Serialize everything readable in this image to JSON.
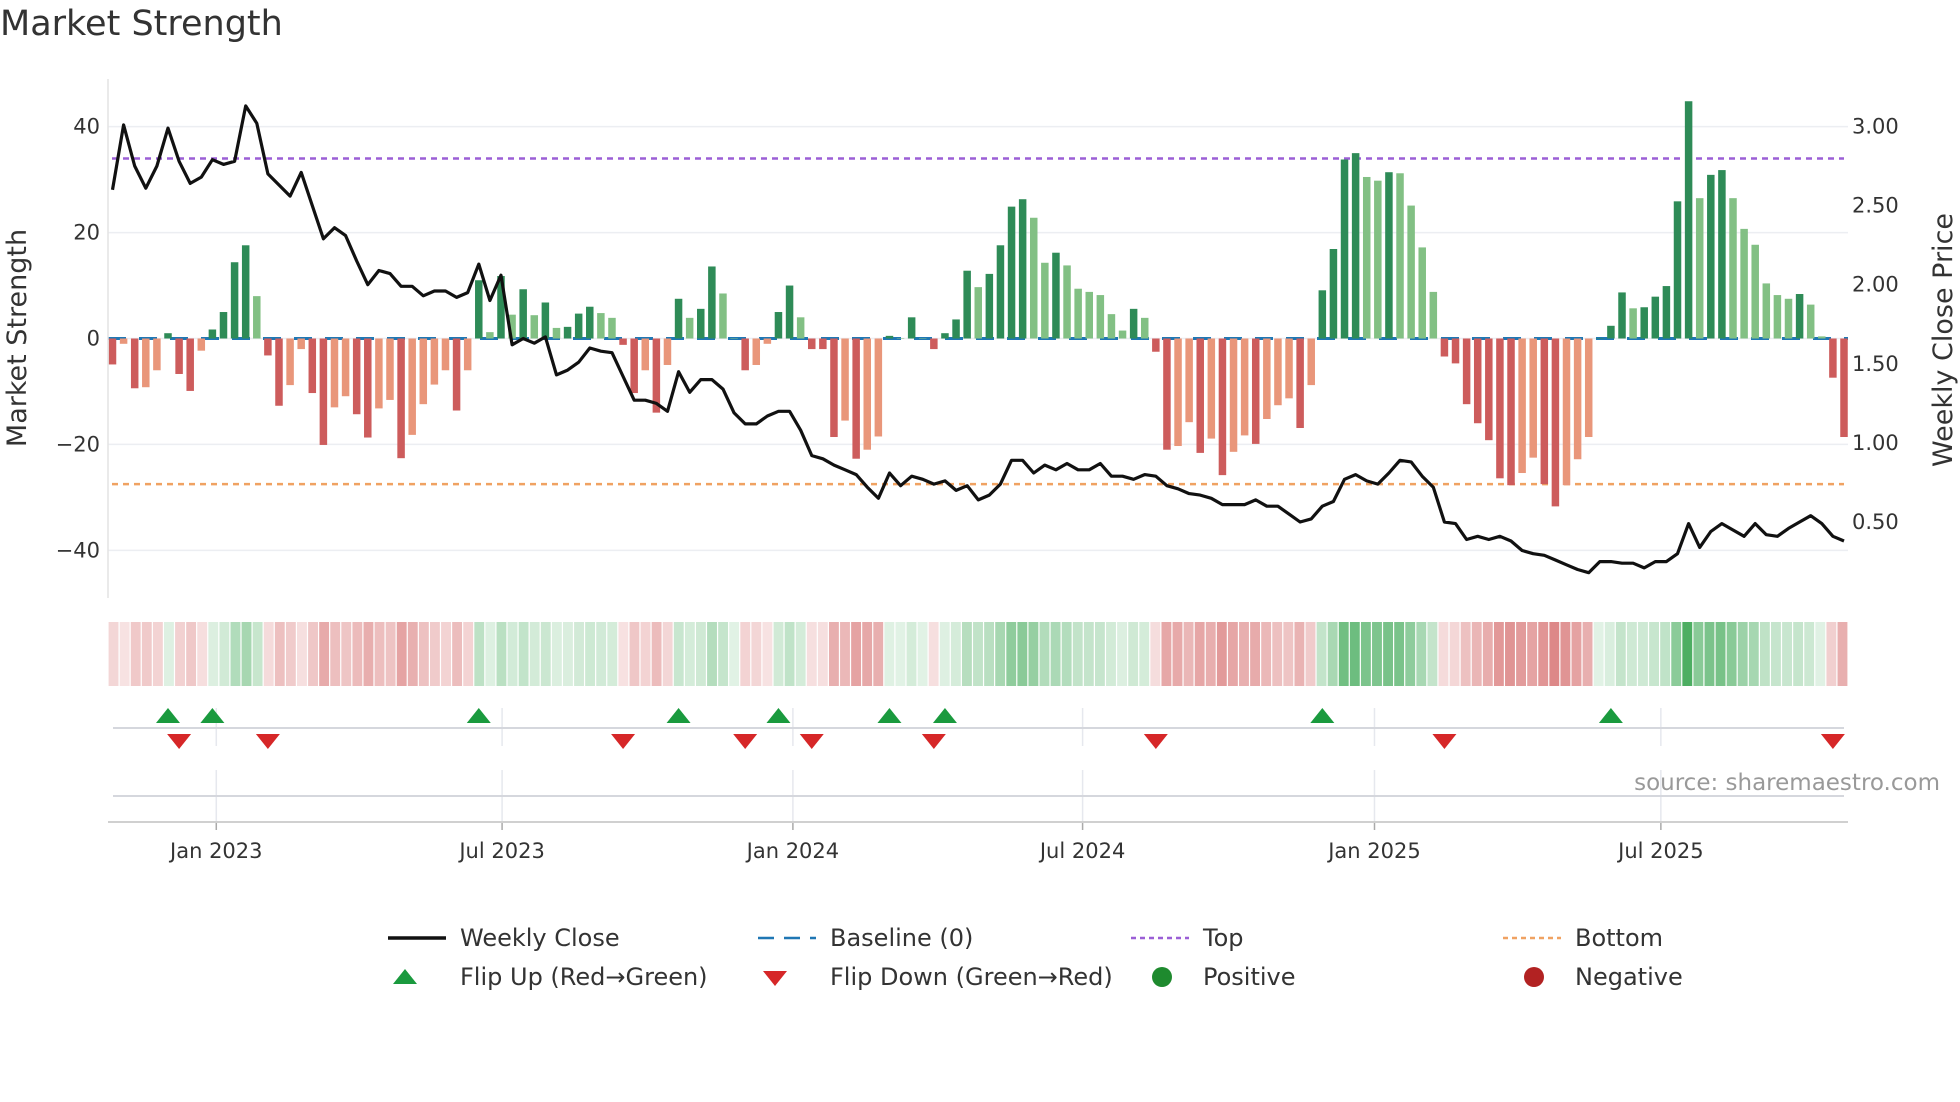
{
  "title": "Market Strength",
  "source": "source: sharemaestro.com",
  "legend": {
    "weekly_close": "Weekly Close",
    "baseline": "Baseline (0)",
    "top": "Top",
    "bottom": "Bottom",
    "flip_up": "Flip Up (Red→Green)",
    "flip_down": "Flip Down (Green→Red)",
    "positive": "Positive",
    "negative": "Negative"
  },
  "colors": {
    "pos_dark": "#2e8b57",
    "pos_light": "#82c084",
    "neg_dark": "#cd5c5c",
    "neg_light": "#e9967a",
    "close": "#111111",
    "top": "#9b5fd6",
    "bottom": "#f0a262",
    "baseline": "#1f77b4",
    "flip_up": "#1a9a3e",
    "flip_down": "#d62728",
    "positive": "#1e8a2e",
    "negative": "#b22222"
  },
  "chart_data": {
    "type": "bar",
    "title": "Market Strength",
    "ylabel": "Market Strength",
    "y2label": "Weekly Close Price",
    "ylim": [
      -49,
      49
    ],
    "y2lim": [
      0.02,
      3.3
    ],
    "yticks": [
      {
        "v": 40,
        "label": "40"
      },
      {
        "v": 20,
        "label": "20"
      },
      {
        "v": 0,
        "label": "0"
      },
      {
        "v": -20,
        "label": "−20"
      },
      {
        "v": -40,
        "label": "−40"
      }
    ],
    "y2ticks": [
      {
        "v": 3.0,
        "label": "3.00"
      },
      {
        "v": 2.5,
        "label": "2.50"
      },
      {
        "v": 2.0,
        "label": "2.00"
      },
      {
        "v": 1.5,
        "label": "1.50"
      },
      {
        "v": 1.0,
        "label": "1.00"
      },
      {
        "v": 0.5,
        "label": "0.50"
      }
    ],
    "xticks": [
      {
        "week": 9.35,
        "label": "Jan 2023"
      },
      {
        "week": 35.1,
        "label": "Jul 2023"
      },
      {
        "week": 61.3,
        "label": "Jan 2024"
      },
      {
        "week": 87.4,
        "label": "Jul 2024"
      },
      {
        "week": 113.7,
        "label": "Jan 2025"
      },
      {
        "week": 139.5,
        "label": "Jul 2025"
      }
    ],
    "top": 34,
    "bottom": -27.5,
    "baseline": 0,
    "strength": [
      -4.9,
      -1,
      -9.4,
      -9.2,
      -6,
      1,
      -6.7,
      -9.9,
      -2.3,
      1.7,
      5,
      14.4,
      17.6,
      8,
      -3.2,
      -12.7,
      -8.8,
      -2,
      -10.3,
      -20.1,
      -13,
      -10.9,
      -14.3,
      -18.7,
      -13.2,
      -11.6,
      -22.6,
      -18.2,
      -12.4,
      -8.7,
      -6,
      -13.6,
      -6,
      11,
      1.2,
      11.8,
      4.5,
      9.3,
      4.4,
      6.8,
      2,
      2.2,
      4.7,
      6,
      4.8,
      3.9,
      -1.2,
      -10.3,
      -6,
      -14,
      -5,
      7.5,
      3.9,
      5.6,
      13.6,
      8.5,
      0,
      -6,
      -5,
      -1,
      5,
      10,
      4,
      -2,
      -2,
      -18.6,
      -15.5,
      -22.7,
      -21,
      -18.5,
      0.5,
      0,
      4,
      0,
      -2,
      1,
      3.6,
      12.8,
      9.7,
      12.2,
      17.6,
      24.9,
      26.3,
      22.8,
      14.3,
      16.2,
      13.8,
      9.4,
      8.8,
      8.2,
      4.6,
      1.5,
      5.6,
      3.9,
      -2.5,
      -21,
      -20.3,
      -15.8,
      -21.6,
      -18.9,
      -25.8,
      -21.4,
      -18.3,
      -19.9,
      -15.2,
      -12.6,
      -11.3,
      -16.9,
      -8.8,
      9.1,
      16.9,
      33.8,
      35,
      30.5,
      29.8,
      31.4,
      31.2,
      25.1,
      17.2,
      8.8,
      -3.4,
      -4.7,
      -12.4,
      -16,
      -19.2,
      -26.4,
      -27.7,
      -25.4,
      -22.5,
      -27.5,
      -31.7,
      -27.7,
      -22.8,
      -18.6,
      0,
      2.4,
      8.7,
      5.7,
      5.9,
      7.9,
      9.9,
      25.9,
      44.8,
      26.5,
      30.9,
      31.8,
      26.5,
      20.7,
      17.7,
      10.4,
      8.2,
      7.5,
      8.4,
      6.4,
      0.4,
      -7.4,
      -18.6
    ],
    "weekly_close": [
      2.6,
      3.01,
      2.75,
      2.61,
      2.75,
      2.99,
      2.78,
      2.64,
      2.68,
      2.79,
      2.76,
      2.78,
      3.13,
      3.02,
      2.7,
      2.63,
      2.56,
      2.71,
      2.5,
      2.29,
      2.36,
      2.31,
      2.15,
      2.0,
      2.09,
      2.07,
      1.99,
      1.99,
      1.93,
      1.96,
      1.96,
      1.92,
      1.95,
      2.13,
      1.9,
      2.06,
      1.62,
      1.66,
      1.63,
      1.67,
      1.43,
      1.46,
      1.51,
      1.6,
      1.58,
      1.57,
      1.42,
      1.27,
      1.27,
      1.25,
      1.2,
      1.45,
      1.32,
      1.4,
      1.4,
      1.34,
      1.19,
      1.12,
      1.12,
      1.17,
      1.2,
      1.2,
      1.08,
      0.92,
      0.9,
      0.86,
      0.83,
      0.8,
      0.72,
      0.65,
      0.81,
      0.73,
      0.79,
      0.77,
      0.74,
      0.76,
      0.7,
      0.73,
      0.64,
      0.67,
      0.74,
      0.89,
      0.89,
      0.81,
      0.86,
      0.83,
      0.87,
      0.83,
      0.83,
      0.87,
      0.79,
      0.79,
      0.77,
      0.8,
      0.79,
      0.73,
      0.71,
      0.68,
      0.67,
      0.65,
      0.61,
      0.61,
      0.61,
      0.64,
      0.6,
      0.6,
      0.55,
      0.5,
      0.52,
      0.6,
      0.63,
      0.77,
      0.8,
      0.76,
      0.74,
      0.81,
      0.89,
      0.88,
      0.79,
      0.72,
      0.5,
      0.49,
      0.39,
      0.41,
      0.39,
      0.41,
      0.38,
      0.32,
      0.3,
      0.29,
      0.26,
      0.23,
      0.2,
      0.18,
      0.25,
      0.25,
      0.24,
      0.24,
      0.21,
      0.25,
      0.25,
      0.3,
      0.49,
      0.34,
      0.44,
      0.49,
      0.45,
      0.41,
      0.49,
      0.42,
      0.41,
      0.46,
      0.5,
      0.54,
      0.49,
      0.41,
      0.38
    ]
  }
}
